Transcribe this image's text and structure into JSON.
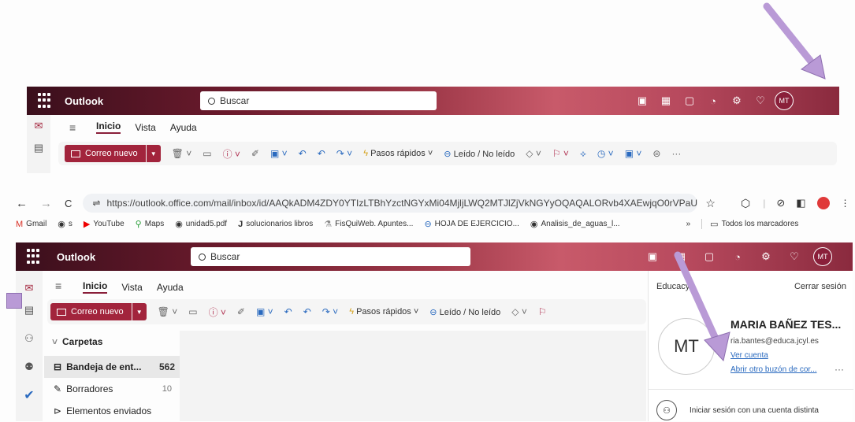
{
  "app": {
    "name": "Outlook",
    "search_placeholder": "Buscar",
    "avatar_initials": "MT"
  },
  "tabs": [
    "Inicio",
    "Vista",
    "Ayuda"
  ],
  "ribbon": {
    "new_mail": "Correo nuevo",
    "quick_steps": "Pasos rápidos",
    "read_unread": "Leído / No leído",
    "more": "···"
  },
  "browser": {
    "url": "https://outlook.office.com/mail/inbox/id/AAQkADM4ZDY0YTIzLTBhYzctNGYxMi04MjljLWQ2MTJlZjVkNGYyOQAQALORvb4XAEwjqO0rVPaUg...",
    "bookmarks": [
      "Gmail",
      "s",
      "YouTube",
      "Maps",
      "unidad5.pdf",
      "solucionarios libros",
      "FisQuiWeb. Apuntes...",
      "HOJA DE EJERCICIO...",
      "Analisis_de_aguas_l..."
    ],
    "all_bookmarks": "Todos los marcadores"
  },
  "folders": {
    "header": "Carpetas",
    "items": [
      {
        "label": "Bandeja de ent...",
        "count": "562"
      },
      {
        "label": "Borradores",
        "count": "10"
      },
      {
        "label": "Elementos enviados",
        "count": ""
      }
    ]
  },
  "account_panel": {
    "org": "Educacy",
    "sign_out": "Cerrar sesión",
    "initials": "MT",
    "name": "MARIA BAÑEZ TES...",
    "email": "ria.bantes@educa.jcyl.es",
    "view_account": "Ver cuenta",
    "open_other_mailbox": "Abrir otro buzón de cor...",
    "more": "···",
    "sign_in_other": "Iniciar sesión con una cuenta distinta"
  },
  "colors": {
    "brand": "#a2243c",
    "arrow": "#b99ad6",
    "link": "#2a6abf"
  }
}
